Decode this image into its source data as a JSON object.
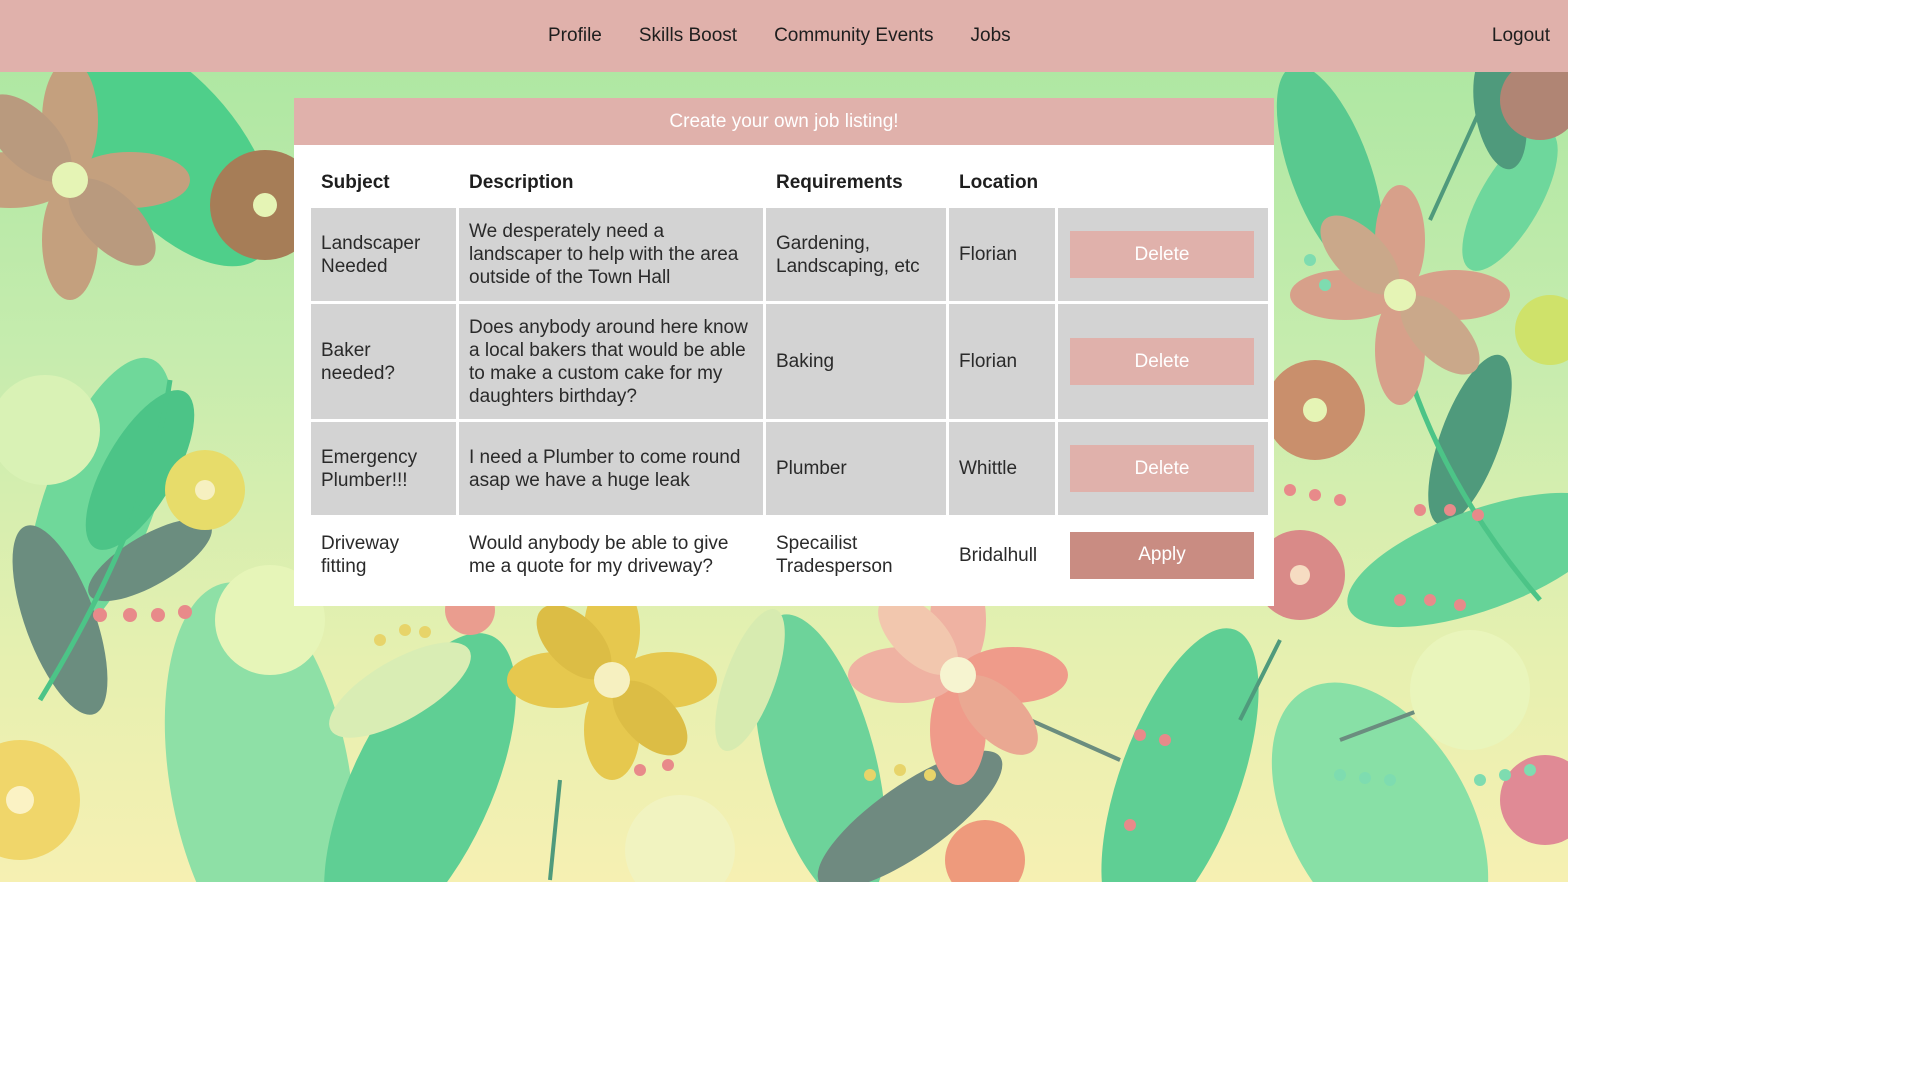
{
  "nav": {
    "links": [
      "Profile",
      "Skills Boost",
      "Community Events",
      "Jobs"
    ],
    "logout": "Logout"
  },
  "card": {
    "title": "Create your own job listing!"
  },
  "table": {
    "headers": [
      "Subject",
      "Description",
      "Requirements",
      "Location"
    ],
    "rows": [
      {
        "subject": "Landscaper Needed",
        "description": "We desperately need a landscaper to help with the area outside of the Town Hall",
        "requirements": "Gardening, Landscaping, etc",
        "location": "Florian",
        "action": "Delete"
      },
      {
        "subject": "Baker needed?",
        "description": "Does anybody around here know a local bakers that would be able to make a custom cake for my daughters birthday?",
        "requirements": "Baking",
        "location": "Florian",
        "action": "Delete"
      },
      {
        "subject": "Emergency Plumber!!!",
        "description": "I need a Plumber to come round asap we have a huge leak",
        "requirements": "Plumber",
        "location": "Whittle",
        "action": "Delete"
      },
      {
        "subject": "Driveway fitting",
        "description": "Would anybody be able to give me a quote for my driveway?",
        "requirements": "Specailist Tradesperson",
        "location": "Bridalhull",
        "action": "Apply"
      }
    ]
  },
  "colors": {
    "header_bar": "#e0b1ab",
    "delete_button": "#e0b1ab",
    "apply_button": "#c98c82",
    "own_row_bg": "#d3d3d3"
  },
  "icons": {
    "background": "floral-pattern"
  }
}
